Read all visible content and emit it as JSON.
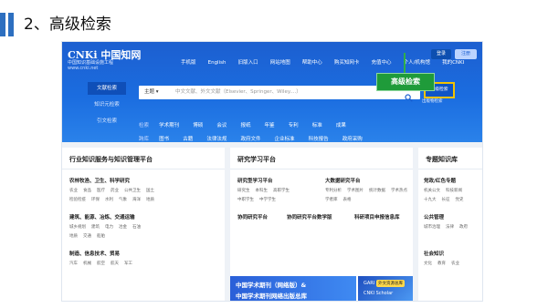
{
  "slide": {
    "title": "2、高级检索"
  },
  "logo": {
    "brand": "CNKi 中国知网",
    "subtitle": "中国知识基础设施工程",
    "url": "www.cnki.net"
  },
  "topnav": [
    "手机版",
    "English",
    "旧版入口",
    "网站地图",
    "帮助中心",
    "购买知网卡",
    "充值中心",
    "个人/机构馆",
    "我的CNKI"
  ],
  "auth": {
    "login": "登录",
    "register": "注册"
  },
  "left_tabs": [
    "文献检索",
    "知识元检索",
    "引文检索"
  ],
  "search": {
    "scope": "主题",
    "placeholder": "中文文献、外文文献（Elsevier、Springer、Wiley....）"
  },
  "advanced": {
    "button": "高级检索",
    "sub": "出版物检索"
  },
  "row1": {
    "label": "检索",
    "items": [
      "学术期刊",
      "博硕",
      "会议",
      "报纸",
      "年鉴",
      "专利",
      "标准",
      "成果"
    ]
  },
  "row2": {
    "label": "跨库",
    "items": [
      "图书",
      "古籍",
      "法律法规",
      "政府文件",
      "企业标准",
      "科技报告",
      "政府采购"
    ]
  },
  "callout": "高级检索",
  "cards": {
    "left": {
      "title": "行业知识服务与知识管理平台",
      "groups": [
        {
          "cat": "农林牧渔、卫生、科学研究",
          "rows": [
            [
              "农业",
              "食品",
              "医疗",
              "药业",
              "公共卫生",
              "国土"
            ],
            [
              "检验检疫",
              "环保",
              "水利",
              "气象",
              "海洋",
              "地质"
            ]
          ]
        },
        {
          "cat": "建筑、能源、冶炼、交通运输",
          "rows": [
            [
              "城乡规划",
              "建筑",
              "电力",
              "冶金",
              "石油"
            ],
            [
              "地质",
              "交通",
              "船舶"
            ]
          ]
        },
        {
          "cat": "制造、信息技术、贸易",
          "rows": [
            [
              "汽车",
              "机械",
              "航空",
              "航天",
              "军工"
            ]
          ]
        }
      ]
    },
    "middle": {
      "title": "研究学习平台",
      "groups": [
        {
          "cat": "研究型学习平台",
          "rows": [
            [
              "研究生",
              "本科生",
              "高职学生",
              "中职学生",
              "中学学生"
            ]
          ]
        },
        {
          "cat": "大数据研究平台",
          "rows": [
            [
              "专利分析",
              "学术图片",
              "统计数据",
              "学术热点",
              "学者库",
              "表格"
            ]
          ]
        },
        {
          "cat": "协同研究平台",
          "rows": []
        },
        {
          "cat": "协同研究平台数学版",
          "rows": []
        },
        {
          "cat": "科研项目申报信息库",
          "rows": []
        }
      ],
      "banner": {
        "line1": "中国学术期刊（网络版）&",
        "line2": "中国学术期刊网络出版总库"
      },
      "banner2": {
        "gari": "GARI",
        "badge": "外文资源总库",
        "line2": "CNKI Scholar"
      }
    },
    "right": {
      "title": "专题知识库",
      "groups": [
        {
          "cat": "党政/红色专题",
          "rows": [
            [
              "机关公文",
              "科技新闻",
              "两学一做",
              "三严三实"
            ],
            [
              "十九大",
              "长征",
              "党史",
              "党建"
            ]
          ]
        },
        {
          "cat": "公共管理",
          "rows": [
            [
              "城市治理",
              "法律",
              "政府",
              "经济"
            ]
          ]
        },
        {
          "cat": "社会知识",
          "rows": [
            [
              "文化",
              "教育",
              "农业"
            ]
          ]
        }
      ]
    }
  }
}
